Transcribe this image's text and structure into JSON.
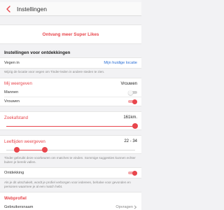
{
  "header": {
    "title": "Instellingen",
    "back_icon": "chevron-left-icon"
  },
  "super_likes": {
    "label": "Ontvang meer Super Likes"
  },
  "discovery": {
    "heading": "Instellingen voor ontdekkingen",
    "location": {
      "label": "Vegen in",
      "value": "Mijn huidige locatie"
    },
    "location_hint": "Wijzig de locatie voor vegen om Tinder-leden in andere steden te zien.",
    "show_me": {
      "label": "Mij weergeven",
      "value": "Vrouwen",
      "options": [
        {
          "label": "Mannen",
          "on": false
        },
        {
          "label": "Vrouwen",
          "on": true
        }
      ]
    },
    "distance": {
      "label": "Zoekafstand",
      "value": "161km.",
      "fraction": 1.0
    },
    "age": {
      "label": "Leeftijden weergeven",
      "value": "22 - 34",
      "min_fraction": 0.08,
      "max_fraction": 0.3
    },
    "hint": "Tinder gebruikt deze voorkeuren om matches te vinden. Sommige suggesties kunnen echter buiten je bereik vallen.",
    "discovery_toggle": {
      "label": "Ontdekking",
      "on": true
    },
    "discovery_hint": "Als je dit uitschakelt, wordt je profiel verborgen voor iedereen, behalve voor gevonden en personen waarmee je al een match hebt."
  },
  "web_profile": {
    "heading": "Webprofiel",
    "username": {
      "label": "Gebruikersnaam",
      "action": "Opvragen"
    }
  },
  "colors": {
    "accent": "#e8464c",
    "link": "#2b6fd6"
  }
}
